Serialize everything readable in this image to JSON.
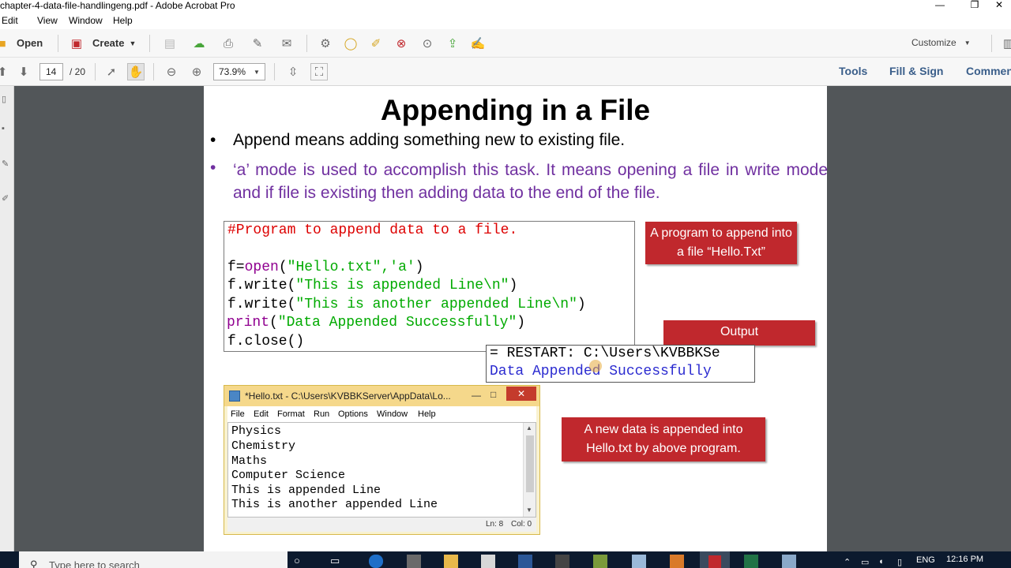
{
  "window": {
    "title": "chapter-4-data-file-handlingeng.pdf - Adobe Acrobat Pro",
    "minimize": "—",
    "maximize": "❐",
    "close": "✕"
  },
  "menu": [
    "Edit",
    "View",
    "Window",
    "Help"
  ],
  "toolbar": {
    "open_label": "Open",
    "create_label": "Create",
    "customize_label": "Customize",
    "page_current": "14",
    "page_total": "/ 20",
    "zoom": "73.9%",
    "tools_label": "Tools",
    "fill_sign_label": "Fill & Sign",
    "comment_label": "Commen"
  },
  "slide": {
    "title": "Appending in a File",
    "bullet1": "Append means adding something new to existing file.",
    "bullet2": "‘a’ mode is used to accomplish this task. It means opening a file in write mode and if file is existing then adding data to the end of the file.",
    "code": {
      "comment": "#Program to append data to a file.",
      "l1a": "f=",
      "l1b": "open",
      "l1c": "(",
      "l1d": "\"Hello.txt\",'a'",
      "l1e": ")",
      "l2a": "f.write(",
      "l2b": "\"This is appended Line\\n\"",
      "l2c": ")",
      "l3a": "f.write(",
      "l3b": "\"This is another appended Line\\n\"",
      "l3c": ")",
      "l4a": "print",
      "l4b": "(",
      "l4c": "\"Data Appended Successfully\"",
      "l4d": ")",
      "l5": "f.close()"
    },
    "callout_program": "A program to append into a file “Hello.Txt”",
    "callout_output": "Output",
    "output_line1": "= RESTART: C:\\Users\\KVBBKSe",
    "output_line2": "Data Appended Successfully",
    "callout_new_data": "A new data is appended into Hello.txt  by above program."
  },
  "notepad": {
    "title": "*Hello.txt - C:\\Users\\KVBBKServer\\AppData\\Lo...",
    "menu": [
      "File",
      "Edit",
      "Format",
      "Run",
      "Options",
      "Window",
      "Help"
    ],
    "lines": [
      "Physics",
      "Chemistry",
      "Maths",
      "Computer Science",
      "This is appended Line",
      "This is another appended Line"
    ],
    "status_ln": "Ln: 8",
    "status_col": "Col: 0"
  },
  "taskbar": {
    "search_placeholder": "Type here to search",
    "lang": "ENG",
    "time": "12:16 PM"
  },
  "colors": {
    "callout_red": "#c0282d",
    "bullet2_purple": "#7030a0",
    "link_blue": "#3a5e8a"
  }
}
